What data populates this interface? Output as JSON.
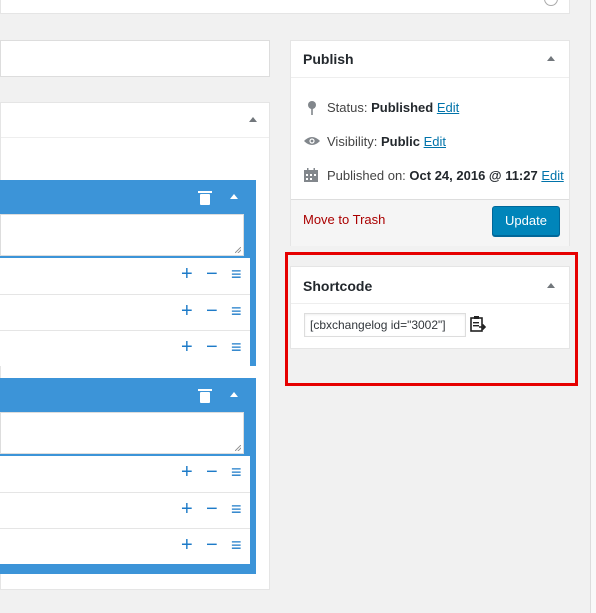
{
  "publish": {
    "title": "Publish",
    "status_label": "Status:",
    "status_value": "Published",
    "status_edit": "Edit",
    "visibility_label": "Visibility:",
    "visibility_value": "Public",
    "visibility_edit": "Edit",
    "published_on_label": "Published on:",
    "published_on_value": "Oct 24, 2016 @ 11:27",
    "published_on_edit": "Edit",
    "trash_label": "Move to Trash",
    "update_label": "Update"
  },
  "shortcode": {
    "title": "Shortcode",
    "value": "[cbxchangelog id=\"3002\"]",
    "copy_icon": "clipboard-copy-icon"
  },
  "repeater": {
    "plus": "+",
    "minus": "−",
    "menu": "≡"
  },
  "colors": {
    "accent_blue": "#3c94d8",
    "button_blue": "#0085ba",
    "trash_red": "#aa0000",
    "highlight_red": "#e60000"
  }
}
